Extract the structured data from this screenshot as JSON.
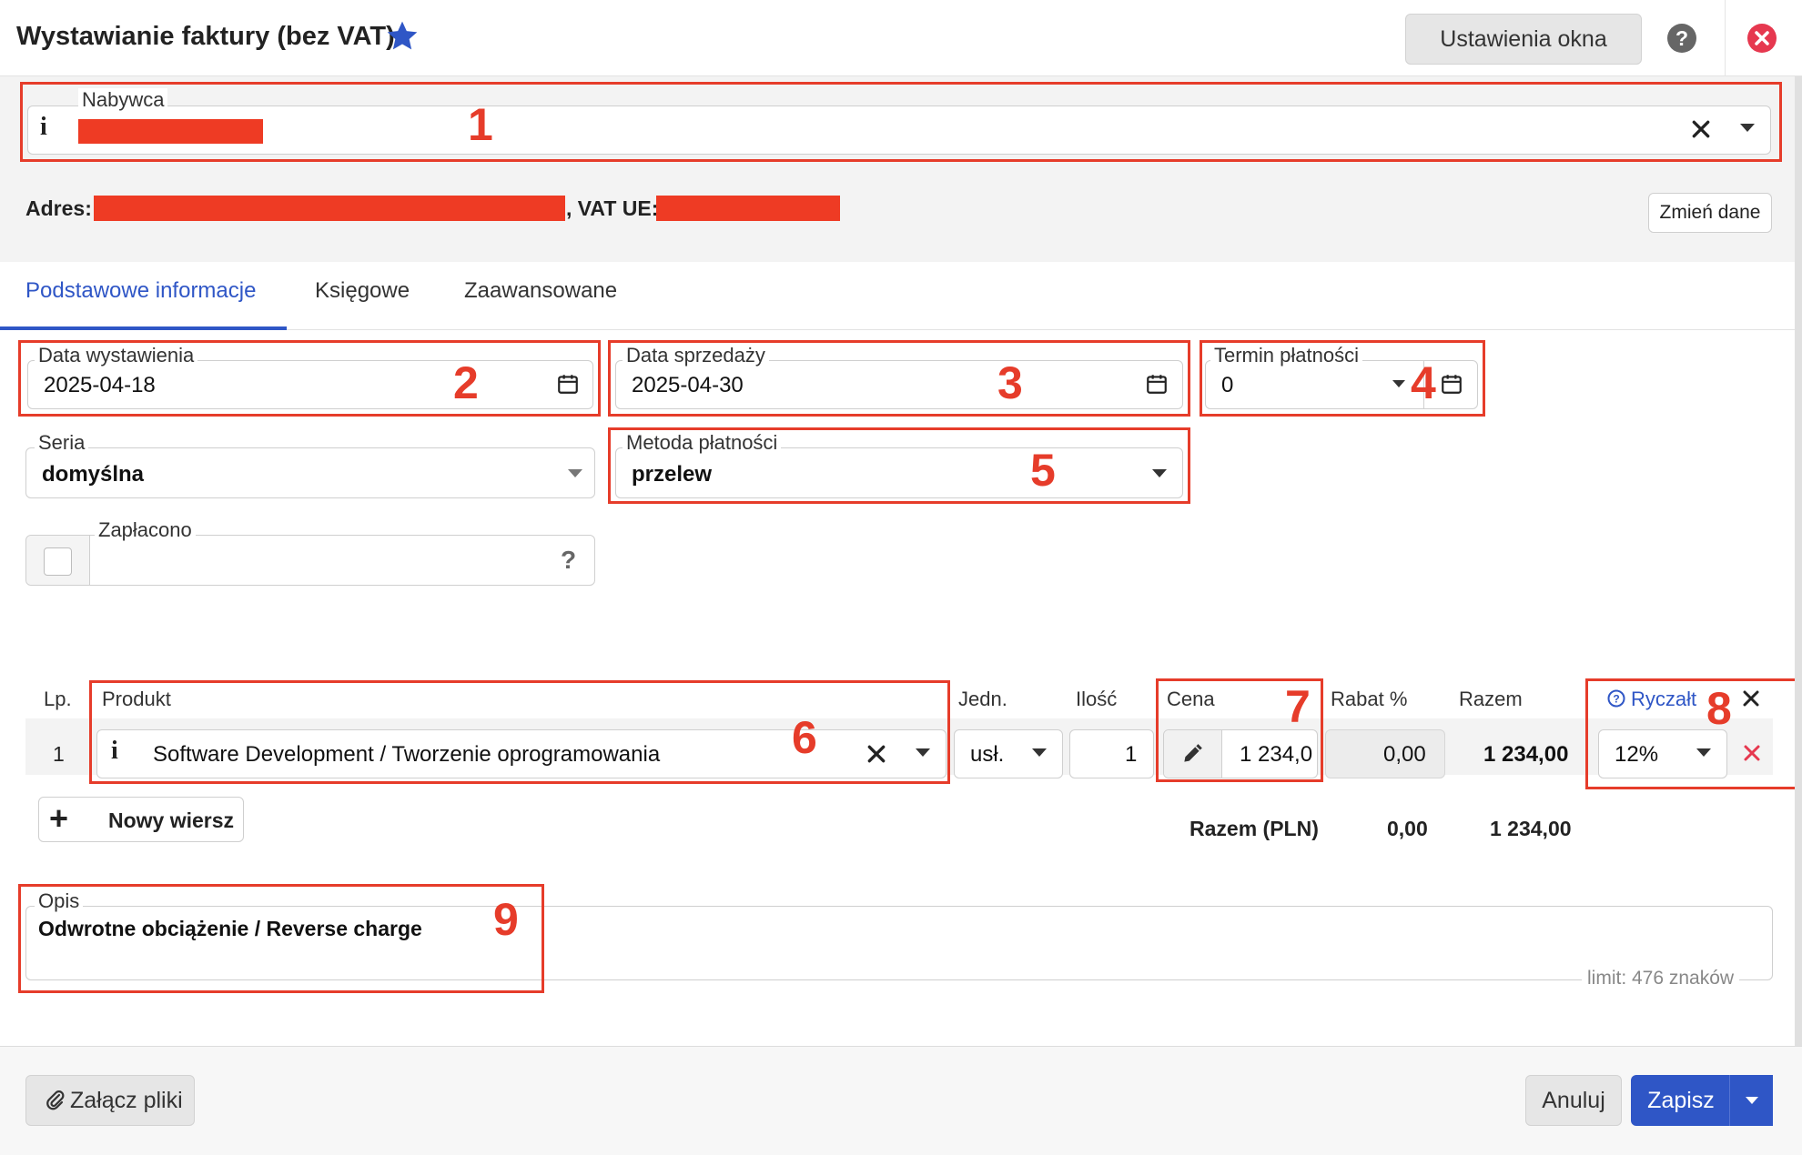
{
  "header": {
    "title": "Wystawianie faktury (bez VAT)",
    "settings_label": "Ustawienia okna",
    "help_glyph": "?",
    "icons": {
      "favorite": "star-icon",
      "help": "help-icon",
      "close": "close-icon"
    }
  },
  "annotations": [
    "1",
    "2",
    "3",
    "4",
    "5",
    "6",
    "7",
    "8",
    "9"
  ],
  "buyer": {
    "label": "Nabywca",
    "address_label": "Adres:",
    "vat_label": ", VAT UE:",
    "change_button": "Zmień dane"
  },
  "tabs": [
    {
      "label": "Podstawowe informacje",
      "active": true
    },
    {
      "label": "Księgowe",
      "active": false
    },
    {
      "label": "Zaawansowane",
      "active": false
    }
  ],
  "fields": {
    "issue_date": {
      "label": "Data wystawienia",
      "value": "2025-04-18"
    },
    "sale_date": {
      "label": "Data sprzedaży",
      "value": "2025-04-30"
    },
    "payment_term": {
      "label": "Termin płatności",
      "value": "0"
    },
    "series": {
      "label": "Seria",
      "value": "domyślna"
    },
    "payment_method": {
      "label": "Metoda płatności",
      "value": "przelew"
    },
    "paid": {
      "label": "Zapłacono",
      "help": "?"
    }
  },
  "items_table": {
    "headers": {
      "lp": "Lp.",
      "product": "Produkt",
      "unit": "Jedn.",
      "qty": "Ilość",
      "price": "Cena",
      "discount": "Rabat %",
      "total": "Razem",
      "flat_rate": "Ryczałt"
    },
    "rows": [
      {
        "lp": "1",
        "product": "Software Development / Tworzenie oprogramowania",
        "unit": "usł.",
        "qty": "1",
        "price": "1 234,0",
        "discount": "0,00",
        "total": "1 234,00",
        "flat_rate": "12%"
      }
    ],
    "new_row_label": "Nowy wiersz",
    "summary": {
      "label": "Razem (PLN)",
      "discount": "0,00",
      "total": "1 234,00"
    }
  },
  "description": {
    "label": "Opis",
    "value": "Odwrotne obciążenie / Reverse charge",
    "limit": "limit: 476 znaków"
  },
  "footer": {
    "attach_label": "Załącz pliki",
    "cancel_label": "Anuluj",
    "save_label": "Zapisz"
  },
  "colors": {
    "accent": "#2f56c6",
    "annotation": "#e63c2a",
    "close": "#e6384f",
    "redaction": "#ee3b24"
  }
}
